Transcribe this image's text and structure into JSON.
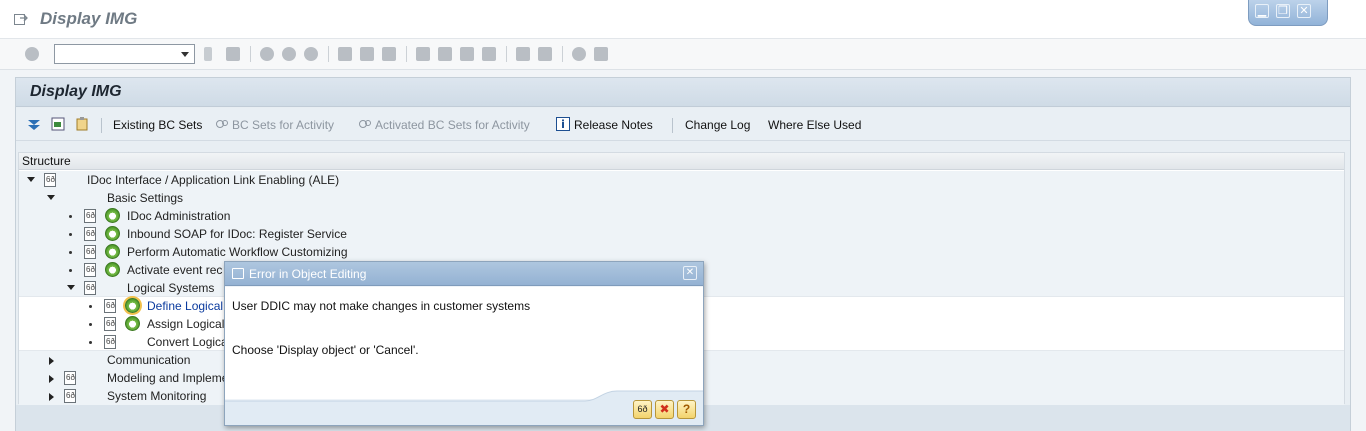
{
  "window": {
    "title": "Display IMG",
    "controls": {
      "minimize": "▁",
      "restore": "❐",
      "close": "✕"
    }
  },
  "toolbar": {
    "command_field": {
      "value": "",
      "placeholder": ""
    }
  },
  "panel": {
    "title": "Display IMG",
    "app_toolbar": {
      "existing_bc_sets": "Existing BC Sets",
      "bc_sets_for_activity": "BC Sets for Activity",
      "activated_bc_sets": "Activated BC Sets for Activity",
      "release_notes": "Release Notes",
      "change_log": "Change Log",
      "where_else_used": "Where Else Used"
    },
    "tree": {
      "column_header": "Structure",
      "rows": [
        {
          "label": "IDoc Interface / Application Link Enabling (ALE)"
        },
        {
          "label": "Basic Settings"
        },
        {
          "label": "IDoc Administration"
        },
        {
          "label": "Inbound SOAP for IDoc: Register Service"
        },
        {
          "label": "Perform Automatic Workflow Customizing"
        },
        {
          "label": "Activate event rec"
        },
        {
          "label": "Logical Systems"
        },
        {
          "label": "Define Logical"
        },
        {
          "label": "Assign Logical"
        },
        {
          "label": "Convert Logica"
        },
        {
          "label": "Communication"
        },
        {
          "label": "Modeling and Impleme"
        },
        {
          "label": "System Monitoring"
        }
      ]
    }
  },
  "dialog": {
    "title": "Error in Object Editing",
    "close": "✕",
    "line1": "User DDIC may not make changes in customer systems",
    "line2": "Choose 'Display object' or 'Cancel'.",
    "buttons": {
      "display": "6ð",
      "cancel": "✖",
      "help": "?"
    }
  },
  "colors": {
    "accent_blue": "#94b2d3",
    "exec_green": "#4f9a2c",
    "button_yellow": "#f3d36c",
    "cancel_red": "#d0301c"
  }
}
